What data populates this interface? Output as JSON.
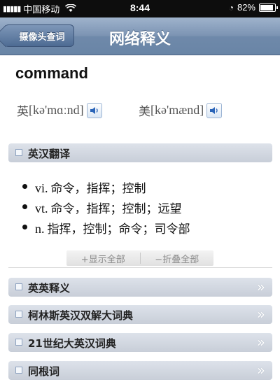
{
  "status_bar": {
    "signal": "▮▮▮▮▮",
    "carrier": "中国移动",
    "wifi_icon": "wifi-icon",
    "time": "8:44",
    "battery": "82%",
    "battery_level": 0.82
  },
  "nav": {
    "back_label": "摄像头查词",
    "title": "网络释义"
  },
  "entry": {
    "word": "command",
    "uk_label": "英",
    "uk_ipa": "[kə'mɑːnd]",
    "us_label": "美",
    "us_ipa": "[kə'mænd]"
  },
  "sections": {
    "ec": "英汉翻译",
    "ee": "英英释义",
    "collins": "柯林斯英汉双解大词典",
    "c21": "21世纪大英汉词典",
    "cognates": "同根词"
  },
  "definitions": [
    {
      "pos": "vi.",
      "text": "命令，指挥；控制"
    },
    {
      "pos": "vt.",
      "text": "命令，指挥；控制；远望"
    },
    {
      "pos": "n.",
      "text": "指挥，控制；命令；司令部"
    }
  ],
  "toggles": {
    "show_all": "+显示全部",
    "collapse_all": "−折叠全部"
  },
  "colors": {
    "nav_bar": "#7b93b2",
    "section_bg": "#d3d9e2"
  }
}
